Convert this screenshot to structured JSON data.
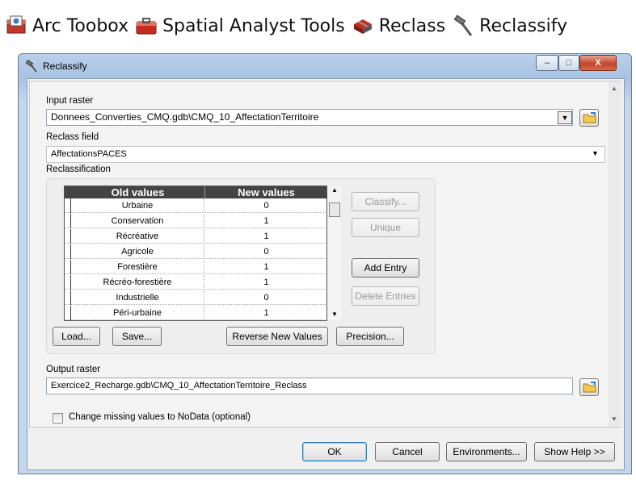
{
  "breadcrumb": [
    {
      "label": "Arc Toobox",
      "icon": "arctoolbox-icon"
    },
    {
      "label": "Spatial Analyst Tools",
      "icon": "toolbox-icon"
    },
    {
      "label": "Reclass",
      "icon": "toolset-icon"
    },
    {
      "label": "Reclassify",
      "icon": "hammer-icon"
    }
  ],
  "window": {
    "title": "Reclassify",
    "controls": {
      "minimize": "–",
      "maximize": "□",
      "close": "X"
    }
  },
  "form": {
    "input_raster_label": "Input raster",
    "input_raster_value": "Donnees_Converties_CMQ.gdb\\CMQ_10_AffectationTerritoire",
    "reclass_field_label": "Reclass field",
    "reclass_field_value": "AffectationsPACES",
    "reclassification_label": "Reclassification",
    "output_raster_label": "Output raster",
    "output_raster_value": "Exercice2_Recharge.gdb\\CMQ_10_AffectationTerritoire_Reclass",
    "nodata_checkbox_label": "Change missing values to NoData (optional)",
    "nodata_checked": false
  },
  "table": {
    "headers": [
      "Old values",
      "New values"
    ],
    "rows": [
      {
        "old": "Urbaine",
        "new": "0"
      },
      {
        "old": "Conservation",
        "new": "1"
      },
      {
        "old": "Récréative",
        "new": "1"
      },
      {
        "old": "Agricole",
        "new": "0"
      },
      {
        "old": "Forestière",
        "new": "1"
      },
      {
        "old": "Récréo-forestière",
        "new": "1"
      },
      {
        "old": "Industrielle",
        "new": "0"
      },
      {
        "old": "Péri-urbaine",
        "new": "1"
      }
    ]
  },
  "side_buttons": {
    "classify": "Classify...",
    "unique": "Unique",
    "add_entry": "Add Entry",
    "delete_entries": "Delete Entries"
  },
  "bottom_buttons": {
    "load": "Load...",
    "save": "Save...",
    "reverse": "Reverse New Values",
    "precision": "Precision..."
  },
  "footer": {
    "ok": "OK",
    "cancel": "Cancel",
    "environments": "Environments...",
    "show_help": "Show Help >>"
  }
}
